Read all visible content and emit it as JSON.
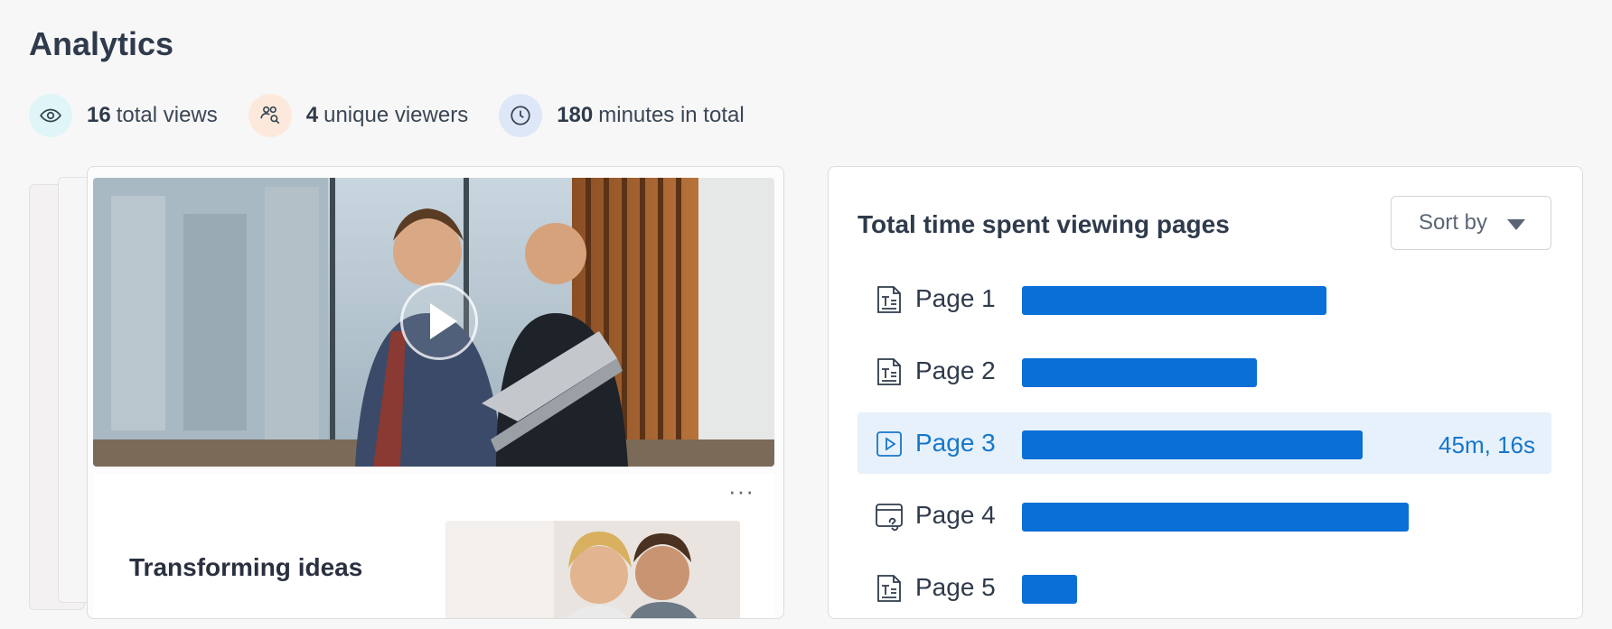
{
  "header": {
    "title": "Analytics"
  },
  "stats": {
    "views": {
      "count": "16",
      "label": "total views",
      "icon": "eye-icon"
    },
    "viewers": {
      "count": "4",
      "label": "unique viewers",
      "icon": "users-search-icon"
    },
    "minutes": {
      "count": "180",
      "label": "minutes in total",
      "icon": "clock-icon"
    }
  },
  "preview": {
    "more_label": "···",
    "slide_title": "Transforming ideas"
  },
  "panel": {
    "title": "Total time spent viewing pages",
    "sort_label": "Sort by",
    "pages": [
      {
        "label": "Page 1",
        "icon": "text-page-icon",
        "fill": 0.66,
        "value": ""
      },
      {
        "label": "Page 2",
        "icon": "text-page-icon",
        "fill": 0.51,
        "value": ""
      },
      {
        "label": "Page 3",
        "icon": "video-page-icon",
        "fill": 0.74,
        "value": "45m, 16s"
      },
      {
        "label": "Page 4",
        "icon": "link-page-icon",
        "fill": 0.84,
        "value": ""
      },
      {
        "label": "Page 5",
        "icon": "text-page-icon",
        "fill": 0.12,
        "value": ""
      }
    ]
  },
  "colors": {
    "bar": "#0a6fd6",
    "active_row": "#e6f1fb",
    "accent_text": "#1877c8"
  }
}
